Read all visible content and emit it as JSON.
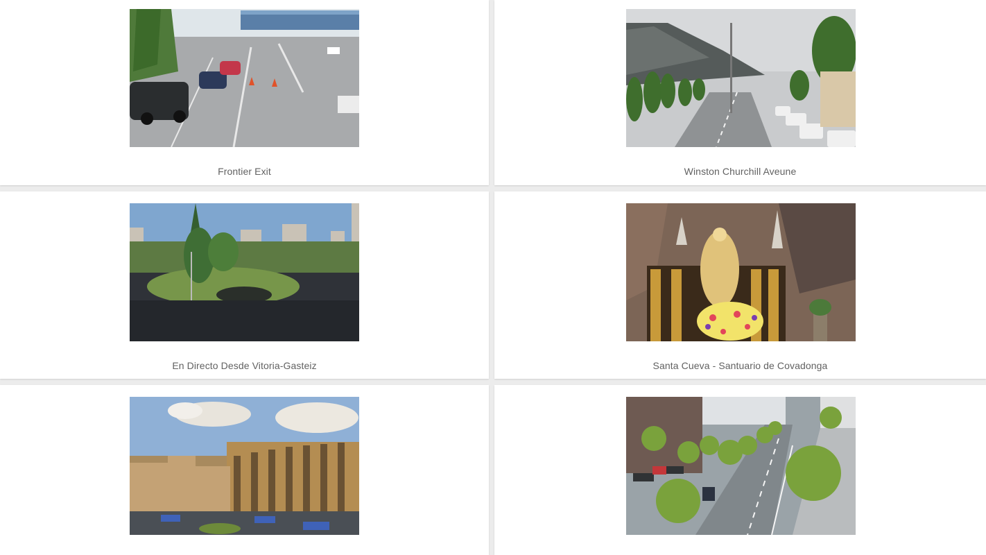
{
  "webcams": [
    {
      "title": "Frontier Exit"
    },
    {
      "title": "Winston Churchill Aveune"
    },
    {
      "title": "En Directo Desde Vitoria-Gasteiz"
    },
    {
      "title": "Santa Cueva - Santuario de Covadonga"
    },
    {
      "title": ""
    },
    {
      "title": ""
    }
  ],
  "colors": {
    "background": "#ececec",
    "card": "#ffffff",
    "caption_text": "#616161"
  }
}
